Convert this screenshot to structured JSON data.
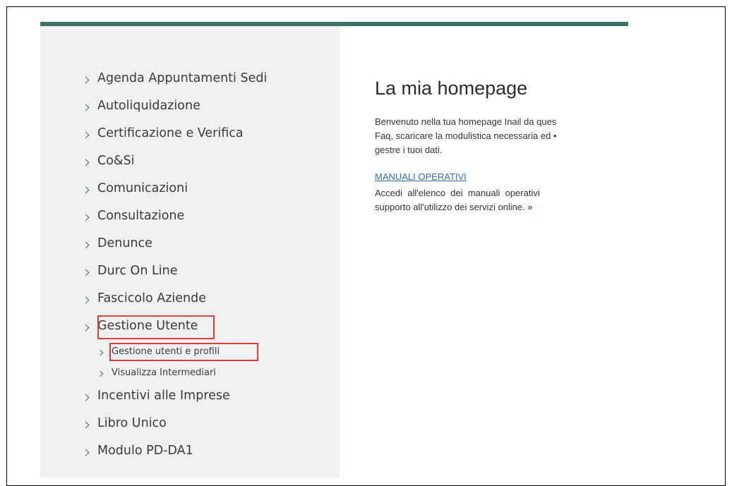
{
  "sidebar": {
    "items": [
      {
        "label": "Agenda Appuntamenti Sedi"
      },
      {
        "label": "Autoliquidazione"
      },
      {
        "label": "Certificazione e Verifica"
      },
      {
        "label": "Co&Si"
      },
      {
        "label": "Comunicazioni"
      },
      {
        "label": "Consultazione"
      },
      {
        "label": "Denunce"
      },
      {
        "label": "Durc On Line"
      },
      {
        "label": "Fascicolo Aziende"
      },
      {
        "label": "Gestione Utente"
      },
      {
        "label": "Gestione utenti e profili"
      },
      {
        "label": "Visualizza Intermediari"
      },
      {
        "label": "Incentivi alle Imprese"
      },
      {
        "label": "Libro Unico"
      },
      {
        "label": "Modulo PD-DA1"
      }
    ]
  },
  "main": {
    "title": "La mia homepage",
    "intro_lines": [
      "Benvenuto nella tua homepage Inail da ques",
      "Faq, scaricare la modulistica necessaria ed •",
      "gestre i tuoi dati."
    ],
    "manuali_link": "MANUALI OPERATIVI",
    "manuali_line1": "Accedi  all'elenco  dei  manuali  operativi",
    "manuali_line2": "supporto all'utilizzo dei servizi online.",
    "more_arrow": "»"
  },
  "colors": {
    "accent_bar": "#3e6f6a",
    "highlight": "#e13b3b",
    "link": "#2f6db6"
  }
}
